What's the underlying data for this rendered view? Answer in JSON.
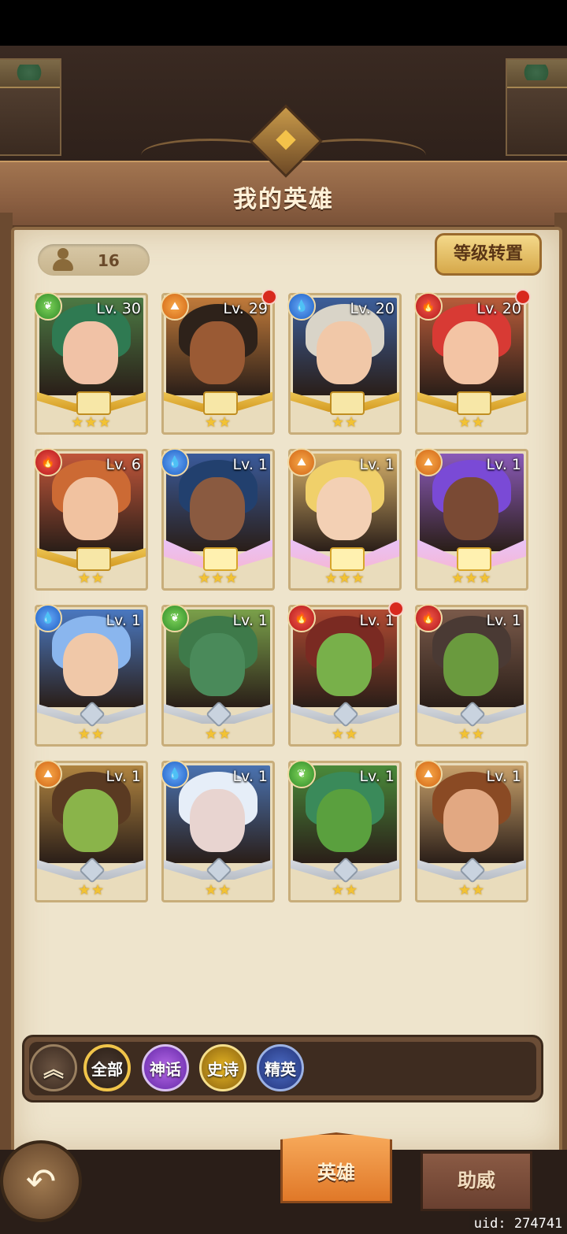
{
  "header": {
    "title": "我的英雄"
  },
  "toolbar": {
    "hero_count": "16",
    "level_reset_label": "等级转置"
  },
  "heroes": [
    {
      "level": "Lv. 30",
      "element": "nature",
      "stars": "★★★",
      "frame": "gold",
      "new": false,
      "skin": "#f1c2a6",
      "hair": "#2f7a52",
      "bg": "#4c7a44"
    },
    {
      "level": "Lv. 29",
      "element": "earth",
      "stars": "★★",
      "frame": "gold",
      "new": true,
      "skin": "#9a5a34",
      "hair": "#2e221a",
      "bg": "#c07a3a"
    },
    {
      "level": "Lv. 20",
      "element": "water",
      "stars": "★★",
      "frame": "gold",
      "new": false,
      "skin": "#f1c8a8",
      "hair": "#d9d4c8",
      "bg": "#3c5e9a"
    },
    {
      "level": "Lv. 20",
      "element": "fire",
      "stars": "★★",
      "frame": "gold",
      "new": true,
      "skin": "#f3c4a4",
      "hair": "#d83a34",
      "bg": "#b85c3a"
    },
    {
      "level": "Lv. 6",
      "element": "fire",
      "stars": "★★",
      "frame": "gold",
      "new": false,
      "skin": "#f1c2a0",
      "hair": "#cc6a34",
      "bg": "#c0563a"
    },
    {
      "level": "Lv. 1",
      "element": "water",
      "stars": "★★★",
      "frame": "pink",
      "new": false,
      "skin": "#8a5a40",
      "hair": "#22406e",
      "bg": "#3a5a9a"
    },
    {
      "level": "Lv. 1",
      "element": "earth",
      "stars": "★★★",
      "frame": "pink",
      "new": false,
      "skin": "#f3d0b4",
      "hair": "#f0d06a",
      "bg": "#d6b06a"
    },
    {
      "level": "Lv. 1",
      "element": "earth",
      "stars": "★★★",
      "frame": "pink",
      "new": false,
      "skin": "#7a4a34",
      "hair": "#7a4ad6",
      "bg": "#8a5ab8"
    },
    {
      "level": "Lv. 1",
      "element": "water",
      "stars": "★★",
      "frame": "silver",
      "new": false,
      "skin": "#f0c8a8",
      "hair": "#8ab6ee",
      "bg": "#4a78c0"
    },
    {
      "level": "Lv. 1",
      "element": "nature",
      "stars": "★★",
      "frame": "silver",
      "new": false,
      "skin": "#4a8a5a",
      "hair": "#3e7a4a",
      "bg": "#7aa04a"
    },
    {
      "level": "Lv. 1",
      "element": "fire",
      "stars": "★★",
      "frame": "silver",
      "new": true,
      "skin": "#78b04a",
      "hair": "#7a2a22",
      "bg": "#b04a32"
    },
    {
      "level": "Lv. 1",
      "element": "fire",
      "stars": "★★",
      "frame": "silver",
      "new": false,
      "skin": "#6a9a3e",
      "hair": "#4a3a34",
      "bg": "#7a5a4a"
    },
    {
      "level": "Lv. 1",
      "element": "earth",
      "stars": "★★",
      "frame": "silver",
      "new": false,
      "skin": "#8ab44a",
      "hair": "#5a3a22",
      "bg": "#b08440"
    },
    {
      "level": "Lv. 1",
      "element": "water",
      "stars": "★★",
      "frame": "silver",
      "new": false,
      "skin": "#e8d4d0",
      "hair": "#e6eef8",
      "bg": "#4a72b0"
    },
    {
      "level": "Lv. 1",
      "element": "nature",
      "stars": "★★",
      "frame": "silver",
      "new": false,
      "skin": "#5aa03e",
      "hair": "#3a8a5a",
      "bg": "#4a8a3a"
    },
    {
      "level": "Lv. 1",
      "element": "earth",
      "stars": "★★",
      "frame": "silver",
      "new": false,
      "skin": "#e2a882",
      "hair": "#8a4a24",
      "bg": "#c8a06a"
    }
  ],
  "filters": {
    "collapse_icon": "chevrons-up",
    "all": "全部",
    "mythic": "神话",
    "epic": "史诗",
    "elite": "精英"
  },
  "tabs": {
    "heroes": "英雄",
    "cheer": "助威"
  },
  "footer": {
    "uid": "uid: 274741"
  },
  "colors": {
    "accent_gold": "#f0c44a",
    "parchment": "#eee4cc",
    "notification": "#d8291e"
  }
}
